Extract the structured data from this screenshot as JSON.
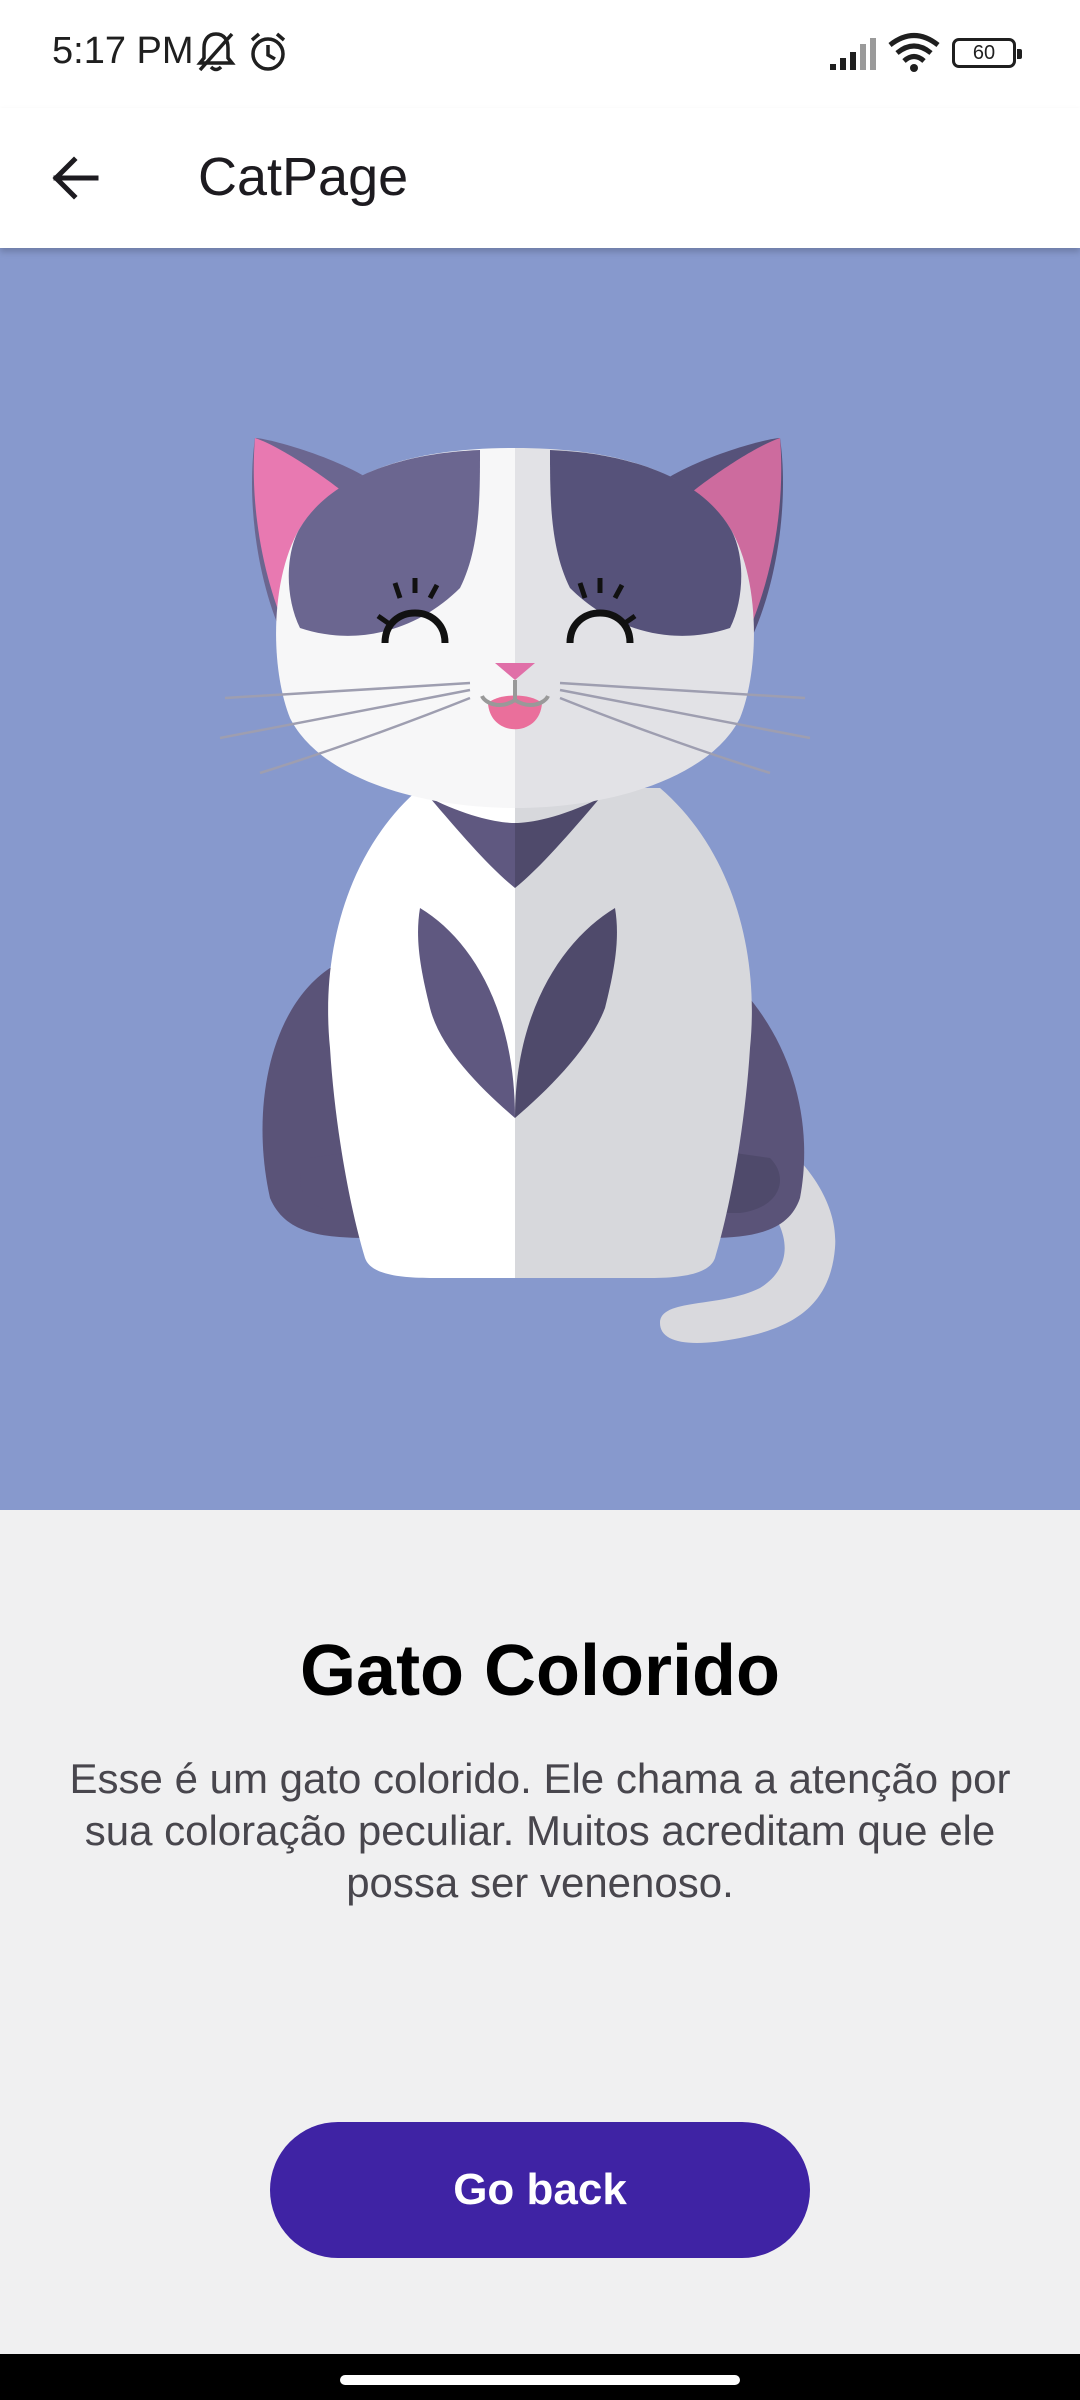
{
  "status_bar": {
    "time": "5:17 PM",
    "battery_level": "60",
    "icons": [
      "bell-off-icon",
      "alarm-icon",
      "signal-icon",
      "wifi-icon",
      "battery-icon"
    ]
  },
  "app_bar": {
    "title": "CatPage",
    "back_icon": "arrow-left-icon"
  },
  "hero": {
    "image": "cat-illustration",
    "background_color": "#8799cd"
  },
  "content": {
    "title": "Gato Colorido",
    "description": "Esse é um gato colorido. Ele chama a atenção por sua coloração peculiar. Muitos acreditam que ele possa ser venenoso.",
    "button_label": "Go back",
    "button_color": "#3f23a4"
  }
}
